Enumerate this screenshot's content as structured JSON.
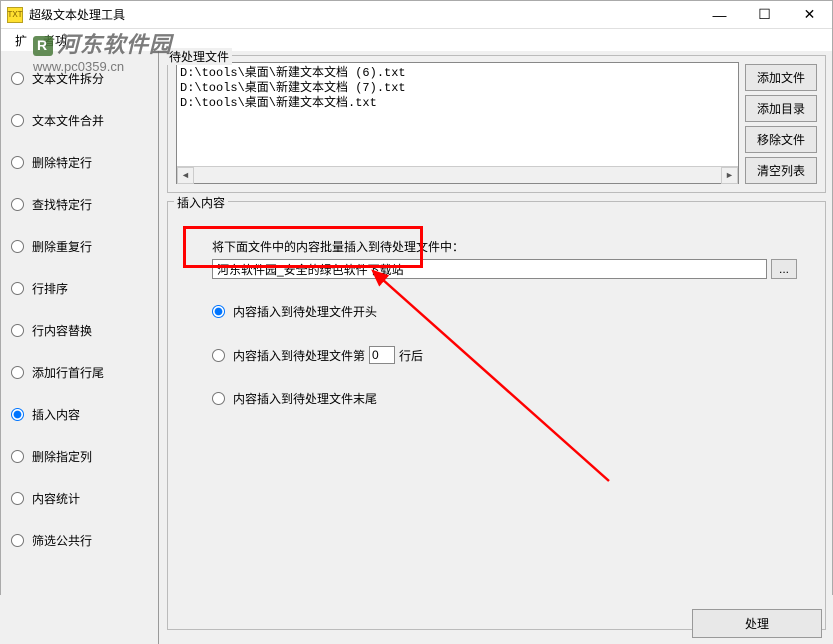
{
  "window": {
    "title": "超级文本处理工具",
    "min": "—",
    "max": "☐",
    "close": "✕"
  },
  "menubar": {
    "file": "扩",
    "help": "者功"
  },
  "watermark": {
    "text": "河东软件园",
    "url": "www.pc0359.cn"
  },
  "sidebar": {
    "options": [
      "文本文件拆分",
      "文本文件合并",
      "删除特定行",
      "查找特定行",
      "删除重复行",
      "行排序",
      "行内容替换",
      "添加行首行尾",
      "插入内容",
      "删除指定列",
      "内容统计",
      "筛选公共行"
    ],
    "selected_index": 8
  },
  "file_group": {
    "label": "待处理文件",
    "files": [
      "D:\\tools\\桌面\\新建文本文档 (6).txt",
      "D:\\tools\\桌面\\新建文本文档 (7).txt",
      "D:\\tools\\桌面\\新建文本文档.txt"
    ],
    "buttons": {
      "add_file": "添加文件",
      "add_dir": "添加目录",
      "remove_file": "移除文件",
      "clear_list": "清空列表"
    }
  },
  "insert_group": {
    "label": "插入内容",
    "instruction": "将下面文件中的内容批量插入到待处理文件中：",
    "input_value": "河东软件园_安全的绿色软件下载站",
    "browse": "...",
    "options": {
      "opt1": "内容插入到待处理文件开头",
      "opt2_prefix": "内容插入到待处理文件第",
      "opt2_value": "0",
      "opt2_suffix": "行后",
      "opt3": "内容插入到待处理文件末尾"
    },
    "selected_option": 0
  },
  "process_button": "处理",
  "colors": {
    "highlight": "#ff0000",
    "arrow": "#ff0000"
  }
}
